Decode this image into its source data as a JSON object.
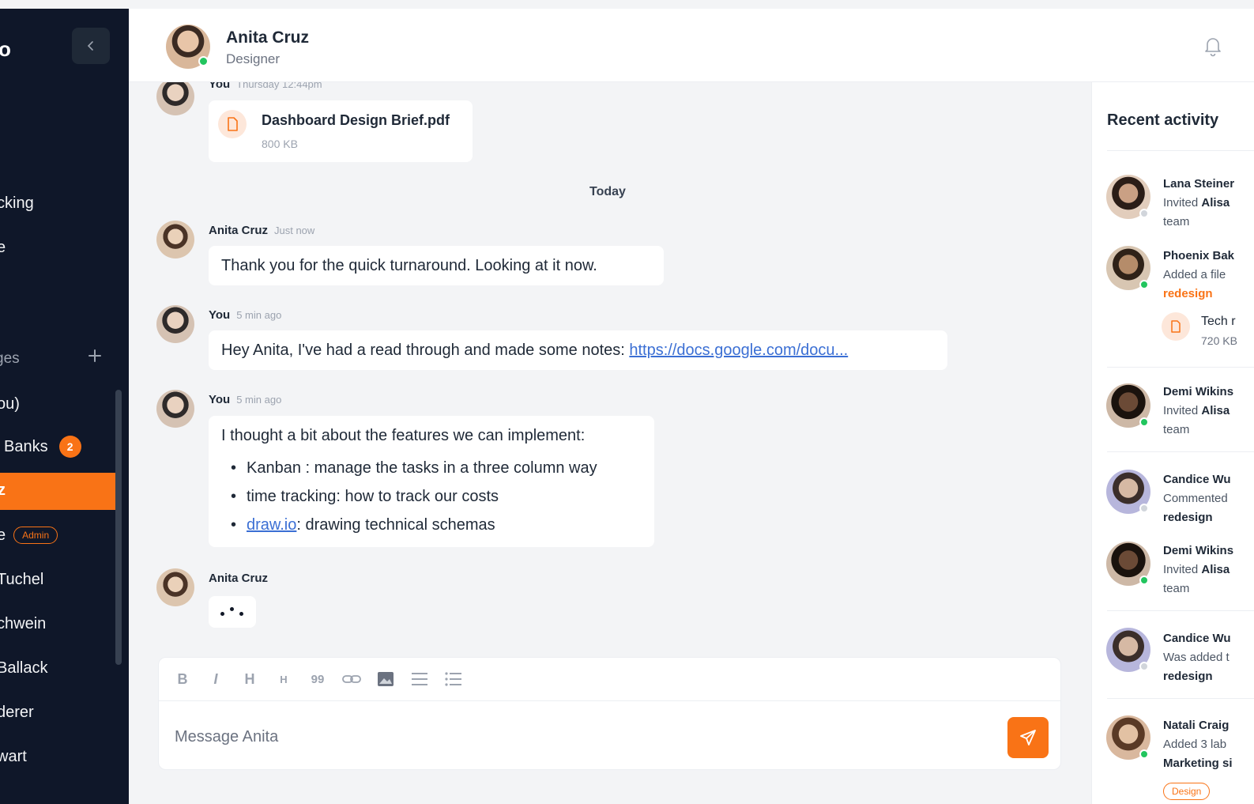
{
  "sidebar": {
    "logo": "o",
    "section_label": "ges",
    "items": [
      {
        "label": "cking",
        "top": 0
      },
      {
        "label": "e"
      },
      {
        "label": "."
      }
    ],
    "dm": [
      {
        "label": "ou)"
      },
      {
        "label": "Banks",
        "badge": "2"
      },
      {
        "label": "z",
        "active": true
      },
      {
        "label": "",
        "admin": "Admin"
      },
      {
        "label": "Tuchel"
      },
      {
        "label": "chwein"
      },
      {
        "label": "Ballack"
      },
      {
        "label": "derer"
      },
      {
        "label": "wart"
      }
    ]
  },
  "header": {
    "name": "Anita Cruz",
    "role": "Designer"
  },
  "chat": {
    "top_partial": {
      "name": "You",
      "time": "Thursday 12:44pm"
    },
    "file": {
      "name": "Dashboard Design Brief.pdf",
      "size": "800 KB"
    },
    "day_separator": "Today",
    "messages": [
      {
        "name": "Anita Cruz",
        "time": "Just now",
        "text": "Thank you for the quick turnaround. Looking at it now."
      },
      {
        "name": "You",
        "time": "5 min ago",
        "text": "Hey Anita, I've had a read through and made some notes: ",
        "link": "https://docs.google.com/docu..."
      },
      {
        "name": "You",
        "time": "5 min ago",
        "text": "I thought a bit about the features we can implement:",
        "list": [
          {
            "text": "Kanban : manage the tasks in a three column way"
          },
          {
            "text": "time tracking: how to track our costs"
          },
          {
            "link": "draw.io",
            "text": ": drawing technical schemas"
          }
        ]
      },
      {
        "name": "Anita Cruz",
        "time": ""
      }
    ]
  },
  "composer": {
    "placeholder": "Message Anita",
    "tools": [
      "B",
      "I",
      "H",
      "H",
      "99"
    ]
  },
  "activity": {
    "title": "Recent activity",
    "items": [
      {
        "name": "Lana Steiner",
        "line1": "Invited ",
        "line1_strong": "Alisa",
        "line2": "team",
        "status": "#d1d5db"
      },
      {
        "name": "Phoenix Bak",
        "line1": "Added a file",
        "link": "redesign",
        "file_name": "Tech r",
        "file_size": "720 KB",
        "status": "#22c55e"
      },
      {
        "name": "Demi Wikins",
        "line1": "Invited ",
        "line1_strong": "Alisa",
        "line2": "team",
        "status": "#22c55e"
      },
      {
        "name": "Candice Wu",
        "line1": "Commented",
        "line2_strong": "redesign",
        "status": "#d1d5db"
      },
      {
        "name": "Demi Wikins",
        "line1": "Invited ",
        "line1_strong": "Alisa",
        "line2": "team",
        "status": "#22c55e"
      },
      {
        "name": "Candice Wu",
        "line1": "Was added t",
        "line2_strong": "redesign",
        "status": "#d1d5db"
      },
      {
        "name": "Natali Craig",
        "line1": "Added 3 lab",
        "line2_strong": "Marketing si",
        "status": "#22c55e",
        "tag": "Design"
      }
    ]
  },
  "colors": {
    "accent": "#f97316",
    "sidebar_bg": "#0f1729",
    "link": "#3b6fd4",
    "online": "#22c55e"
  }
}
